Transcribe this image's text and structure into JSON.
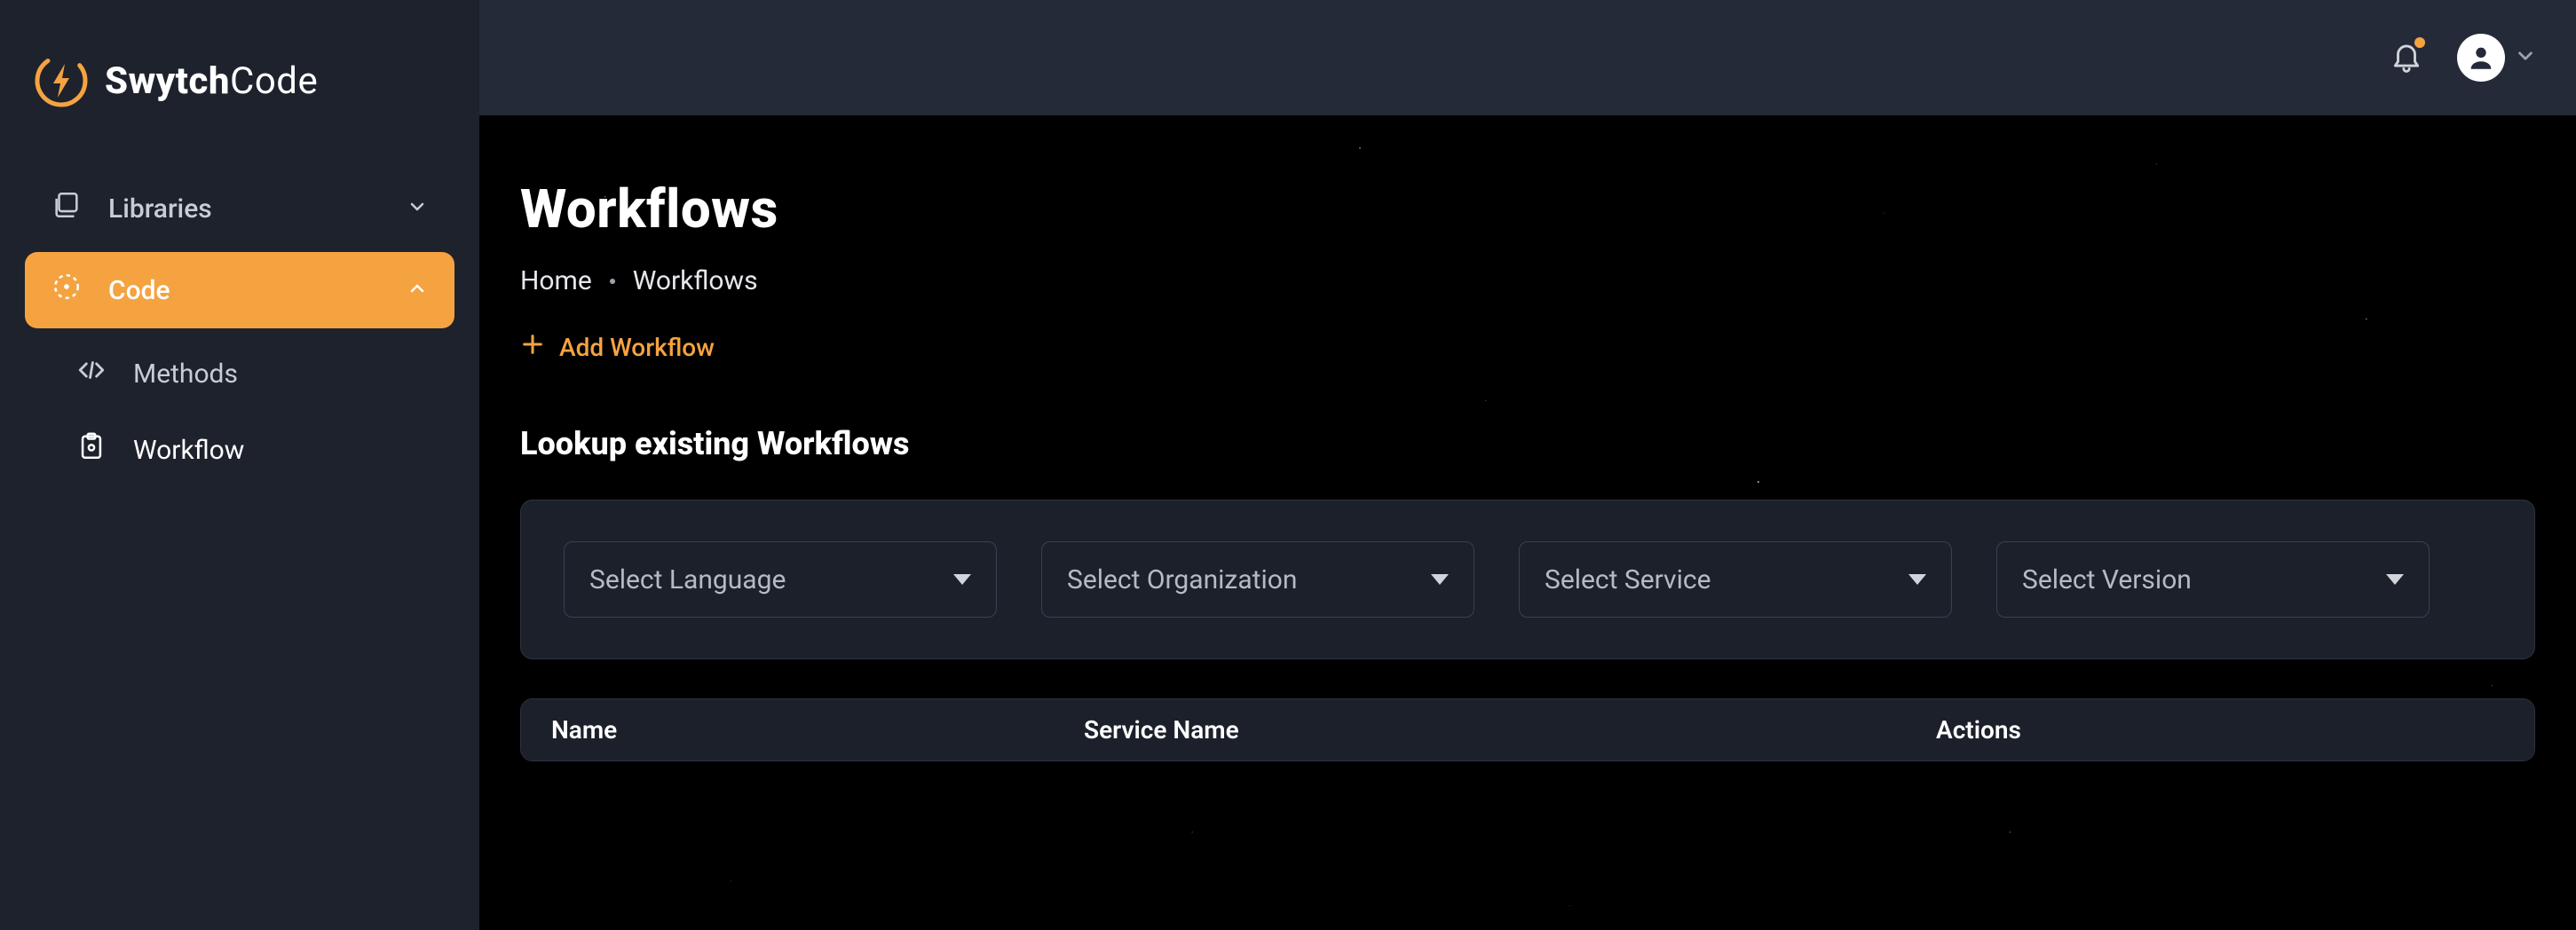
{
  "brand": {
    "bold": "Swytch",
    "light": "Code"
  },
  "sidebar": {
    "items": [
      {
        "label": "Libraries",
        "expanded": false,
        "active": false
      },
      {
        "label": "Code",
        "expanded": true,
        "active": true
      }
    ],
    "code_children": [
      {
        "label": "Methods",
        "active": false
      },
      {
        "label": "Workflow",
        "active": true
      }
    ]
  },
  "page": {
    "title": "Workflows",
    "breadcrumb": {
      "home": "Home",
      "current": "Workflows"
    },
    "add_label": "Add Workflow",
    "section_title": "Lookup existing Workflows",
    "filters": {
      "language": "Select Language",
      "organization": "Select Organization",
      "service": "Select Service",
      "version": "Select Version"
    },
    "table": {
      "columns": {
        "name": "Name",
        "service_name": "Service Name",
        "actions": "Actions"
      },
      "rows": []
    }
  },
  "colors": {
    "accent": "#f5a340",
    "bg": "#1e222d",
    "panel": "#252a38",
    "canvas": "#000000"
  }
}
